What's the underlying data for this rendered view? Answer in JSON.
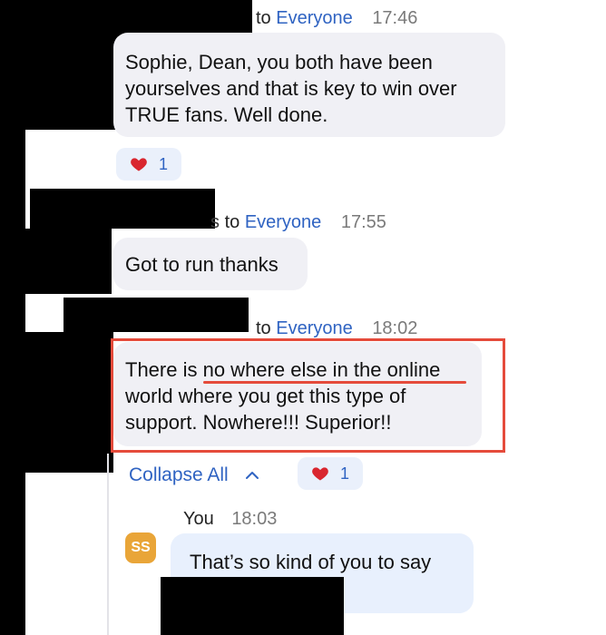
{
  "messages": [
    {
      "to_label": "to",
      "recipient": "Everyone",
      "time": "17:46",
      "text": "Sophie, Dean, you both have been\nyourselves and that is  key to win over\nTRUE fans. Well done.",
      "reaction": {
        "emoji": "heart-icon",
        "count": "1"
      }
    },
    {
      "to_label": "to",
      "recipient": "Everyone",
      "time": "17:55",
      "text": "Got to run thanks"
    },
    {
      "to_label": "to",
      "recipient": "Everyone",
      "time": "18:02",
      "text_part1": "There is ",
      "text_highlight": "no where else in the online",
      "text_rest": "world where you get this type of\nsupport. Nowhere!!! Superior!!",
      "reaction": {
        "emoji": "heart-icon",
        "count": "1"
      }
    }
  ],
  "thread": {
    "collapse_label": "Collapse All",
    "reply": {
      "avatar_initials": "SS",
      "sender": "You",
      "time": "18:03",
      "text": "That’s so kind of you to say"
    }
  },
  "colors": {
    "link": "#2f63c2",
    "highlight": "#e54b3b",
    "avatar": "#e9a538"
  }
}
